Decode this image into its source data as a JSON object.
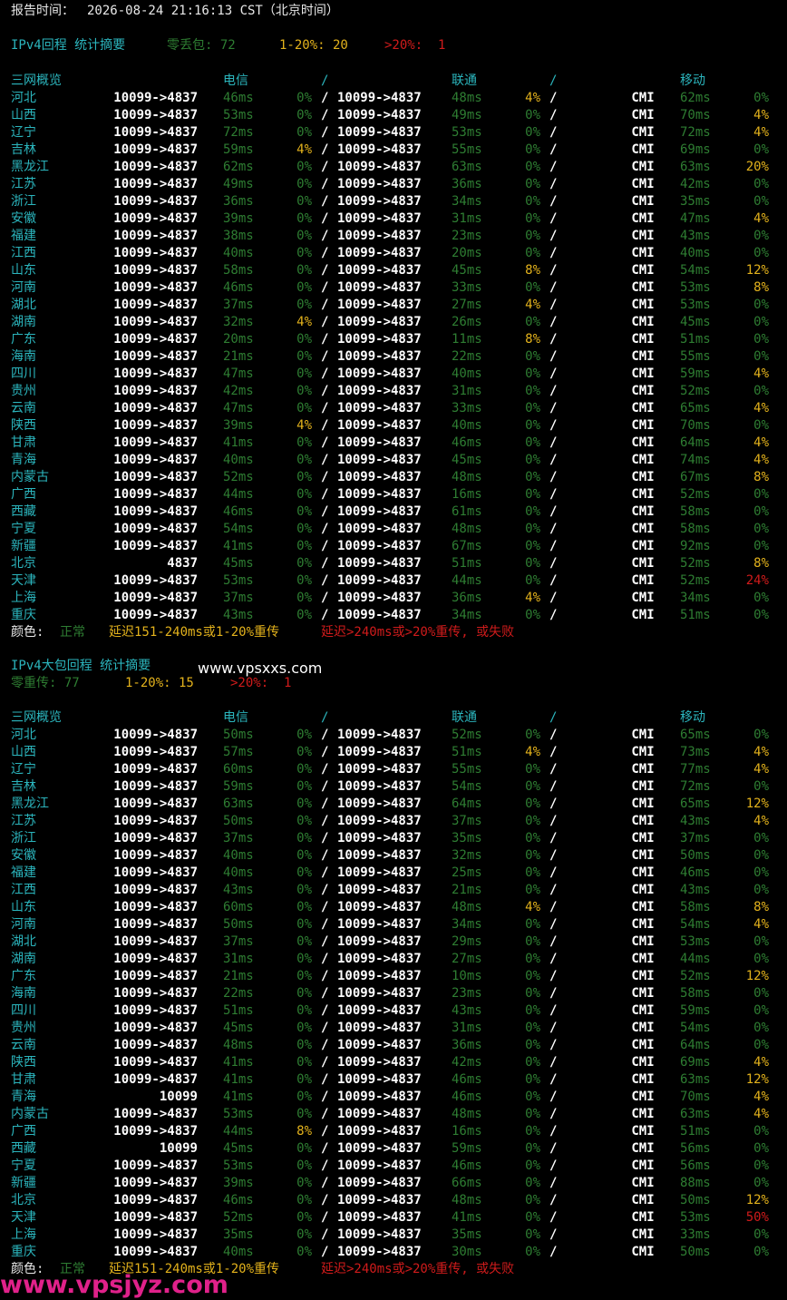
{
  "report": {
    "label": "报告时间：",
    "time": "2026-08-24 21:16:13 CST（北京时间）"
  },
  "colors": {
    "normal": "#2e7d32",
    "warn": "#e3b21c",
    "bad": "#d01b1b",
    "accent": "#2bb5bd"
  },
  "sections": [
    {
      "title": "IPv4回程 统计摘要",
      "summary": {
        "zero_label": "零丢包: 72",
        "mid_label": "1-20%: 20",
        "high_label": ">20%:  1"
      },
      "summary_inline": true,
      "header": {
        "region": "三网概览",
        "ct": "电信",
        "sep": "/",
        "cu": "联通",
        "cm": "移动"
      },
      "rows": [
        [
          "河北",
          "10099->4837",
          "46ms",
          "0%",
          "10099->4837",
          "48ms",
          "4%",
          "CMI",
          "62ms",
          "0%"
        ],
        [
          "山西",
          "10099->4837",
          "53ms",
          "0%",
          "10099->4837",
          "49ms",
          "0%",
          "CMI",
          "70ms",
          "4%"
        ],
        [
          "辽宁",
          "10099->4837",
          "72ms",
          "0%",
          "10099->4837",
          "53ms",
          "0%",
          "CMI",
          "72ms",
          "4%"
        ],
        [
          "吉林",
          "10099->4837",
          "59ms",
          "4%",
          "10099->4837",
          "55ms",
          "0%",
          "CMI",
          "69ms",
          "0%"
        ],
        [
          "黑龙江",
          "10099->4837",
          "62ms",
          "0%",
          "10099->4837",
          "63ms",
          "0%",
          "CMI",
          "63ms",
          "20%"
        ],
        [
          "江苏",
          "10099->4837",
          "49ms",
          "0%",
          "10099->4837",
          "36ms",
          "0%",
          "CMI",
          "42ms",
          "0%"
        ],
        [
          "浙江",
          "10099->4837",
          "36ms",
          "0%",
          "10099->4837",
          "34ms",
          "0%",
          "CMI",
          "35ms",
          "0%"
        ],
        [
          "安徽",
          "10099->4837",
          "39ms",
          "0%",
          "10099->4837",
          "31ms",
          "0%",
          "CMI",
          "47ms",
          "4%"
        ],
        [
          "福建",
          "10099->4837",
          "38ms",
          "0%",
          "10099->4837",
          "23ms",
          "0%",
          "CMI",
          "43ms",
          "0%"
        ],
        [
          "江西",
          "10099->4837",
          "40ms",
          "0%",
          "10099->4837",
          "20ms",
          "0%",
          "CMI",
          "40ms",
          "0%"
        ],
        [
          "山东",
          "10099->4837",
          "58ms",
          "0%",
          "10099->4837",
          "45ms",
          "8%",
          "CMI",
          "54ms",
          "12%"
        ],
        [
          "河南",
          "10099->4837",
          "46ms",
          "0%",
          "10099->4837",
          "33ms",
          "0%",
          "CMI",
          "53ms",
          "8%"
        ],
        [
          "湖北",
          "10099->4837",
          "37ms",
          "0%",
          "10099->4837",
          "27ms",
          "4%",
          "CMI",
          "53ms",
          "0%"
        ],
        [
          "湖南",
          "10099->4837",
          "32ms",
          "4%",
          "10099->4837",
          "26ms",
          "0%",
          "CMI",
          "45ms",
          "0%"
        ],
        [
          "广东",
          "10099->4837",
          "20ms",
          "0%",
          "10099->4837",
          "11ms",
          "8%",
          "CMI",
          "51ms",
          "0%"
        ],
        [
          "海南",
          "10099->4837",
          "21ms",
          "0%",
          "10099->4837",
          "22ms",
          "0%",
          "CMI",
          "55ms",
          "0%"
        ],
        [
          "四川",
          "10099->4837",
          "47ms",
          "0%",
          "10099->4837",
          "40ms",
          "0%",
          "CMI",
          "59ms",
          "4%"
        ],
        [
          "贵州",
          "10099->4837",
          "42ms",
          "0%",
          "10099->4837",
          "31ms",
          "0%",
          "CMI",
          "52ms",
          "0%"
        ],
        [
          "云南",
          "10099->4837",
          "47ms",
          "0%",
          "10099->4837",
          "33ms",
          "0%",
          "CMI",
          "65ms",
          "4%"
        ],
        [
          "陕西",
          "10099->4837",
          "39ms",
          "4%",
          "10099->4837",
          "40ms",
          "0%",
          "CMI",
          "70ms",
          "0%"
        ],
        [
          "甘肃",
          "10099->4837",
          "41ms",
          "0%",
          "10099->4837",
          "46ms",
          "0%",
          "CMI",
          "64ms",
          "4%"
        ],
        [
          "青海",
          "10099->4837",
          "40ms",
          "0%",
          "10099->4837",
          "45ms",
          "0%",
          "CMI",
          "74ms",
          "4%"
        ],
        [
          "内蒙古",
          "10099->4837",
          "52ms",
          "0%",
          "10099->4837",
          "48ms",
          "0%",
          "CMI",
          "67ms",
          "8%"
        ],
        [
          "广西",
          "10099->4837",
          "44ms",
          "0%",
          "10099->4837",
          "16ms",
          "0%",
          "CMI",
          "52ms",
          "0%"
        ],
        [
          "西藏",
          "10099->4837",
          "46ms",
          "0%",
          "10099->4837",
          "61ms",
          "0%",
          "CMI",
          "58ms",
          "0%"
        ],
        [
          "宁夏",
          "10099->4837",
          "54ms",
          "0%",
          "10099->4837",
          "48ms",
          "0%",
          "CMI",
          "58ms",
          "0%"
        ],
        [
          "新疆",
          "10099->4837",
          "41ms",
          "0%",
          "10099->4837",
          "67ms",
          "0%",
          "CMI",
          "92ms",
          "0%"
        ],
        [
          "北京",
          "4837",
          "45ms",
          "0%",
          "10099->4837",
          "51ms",
          "0%",
          "CMI",
          "52ms",
          "8%"
        ],
        [
          "天津",
          "10099->4837",
          "53ms",
          "0%",
          "10099->4837",
          "44ms",
          "0%",
          "CMI",
          "52ms",
          "24%"
        ],
        [
          "上海",
          "10099->4837",
          "37ms",
          "0%",
          "10099->4837",
          "36ms",
          "4%",
          "CMI",
          "34ms",
          "0%"
        ],
        [
          "重庆",
          "10099->4837",
          "43ms",
          "0%",
          "10099->4837",
          "34ms",
          "0%",
          "CMI",
          "51ms",
          "0%"
        ]
      ],
      "legend": {
        "label": "颜色:",
        "normal": "正常",
        "warn": "延迟151-240ms或1-20%重传",
        "bad": "延迟>240ms或>20%重传, 或失败"
      }
    },
    {
      "title": "IPv4大包回程 统计摘要",
      "summary": {
        "zero_label": "零重传: 77",
        "mid_label": "1-20%: 15",
        "high_label": ">20%:  1"
      },
      "summary_inline": false,
      "header": {
        "region": "三网概览",
        "ct": "电信",
        "sep": "/",
        "cu": "联通",
        "cm": "移动"
      },
      "rows": [
        [
          "河北",
          "10099->4837",
          "50ms",
          "0%",
          "10099->4837",
          "52ms",
          "0%",
          "CMI",
          "65ms",
          "0%"
        ],
        [
          "山西",
          "10099->4837",
          "57ms",
          "0%",
          "10099->4837",
          "51ms",
          "4%",
          "CMI",
          "73ms",
          "4%"
        ],
        [
          "辽宁",
          "10099->4837",
          "60ms",
          "0%",
          "10099->4837",
          "55ms",
          "0%",
          "CMI",
          "77ms",
          "4%"
        ],
        [
          "吉林",
          "10099->4837",
          "59ms",
          "0%",
          "10099->4837",
          "54ms",
          "0%",
          "CMI",
          "72ms",
          "0%"
        ],
        [
          "黑龙江",
          "10099->4837",
          "63ms",
          "0%",
          "10099->4837",
          "64ms",
          "0%",
          "CMI",
          "65ms",
          "12%"
        ],
        [
          "江苏",
          "10099->4837",
          "50ms",
          "0%",
          "10099->4837",
          "37ms",
          "0%",
          "CMI",
          "43ms",
          "4%"
        ],
        [
          "浙江",
          "10099->4837",
          "37ms",
          "0%",
          "10099->4837",
          "35ms",
          "0%",
          "CMI",
          "37ms",
          "0%"
        ],
        [
          "安徽",
          "10099->4837",
          "40ms",
          "0%",
          "10099->4837",
          "32ms",
          "0%",
          "CMI",
          "50ms",
          "0%"
        ],
        [
          "福建",
          "10099->4837",
          "40ms",
          "0%",
          "10099->4837",
          "25ms",
          "0%",
          "CMI",
          "46ms",
          "0%"
        ],
        [
          "江西",
          "10099->4837",
          "43ms",
          "0%",
          "10099->4837",
          "21ms",
          "0%",
          "CMI",
          "43ms",
          "0%"
        ],
        [
          "山东",
          "10099->4837",
          "60ms",
          "0%",
          "10099->4837",
          "48ms",
          "4%",
          "CMI",
          "58ms",
          "8%"
        ],
        [
          "河南",
          "10099->4837",
          "50ms",
          "0%",
          "10099->4837",
          "34ms",
          "0%",
          "CMI",
          "54ms",
          "4%"
        ],
        [
          "湖北",
          "10099->4837",
          "37ms",
          "0%",
          "10099->4837",
          "29ms",
          "0%",
          "CMI",
          "53ms",
          "0%"
        ],
        [
          "湖南",
          "10099->4837",
          "31ms",
          "0%",
          "10099->4837",
          "27ms",
          "0%",
          "CMI",
          "44ms",
          "0%"
        ],
        [
          "广东",
          "10099->4837",
          "21ms",
          "0%",
          "10099->4837",
          "10ms",
          "0%",
          "CMI",
          "52ms",
          "12%"
        ],
        [
          "海南",
          "10099->4837",
          "22ms",
          "0%",
          "10099->4837",
          "23ms",
          "0%",
          "CMI",
          "58ms",
          "0%"
        ],
        [
          "四川",
          "10099->4837",
          "51ms",
          "0%",
          "10099->4837",
          "43ms",
          "0%",
          "CMI",
          "59ms",
          "0%"
        ],
        [
          "贵州",
          "10099->4837",
          "45ms",
          "0%",
          "10099->4837",
          "31ms",
          "0%",
          "CMI",
          "54ms",
          "0%"
        ],
        [
          "云南",
          "10099->4837",
          "48ms",
          "0%",
          "10099->4837",
          "36ms",
          "0%",
          "CMI",
          "64ms",
          "0%"
        ],
        [
          "陕西",
          "10099->4837",
          "41ms",
          "0%",
          "10099->4837",
          "42ms",
          "0%",
          "CMI",
          "69ms",
          "4%"
        ],
        [
          "甘肃",
          "10099->4837",
          "41ms",
          "0%",
          "10099->4837",
          "46ms",
          "0%",
          "CMI",
          "63ms",
          "12%"
        ],
        [
          "青海",
          "10099",
          "41ms",
          "0%",
          "10099->4837",
          "46ms",
          "0%",
          "CMI",
          "70ms",
          "4%"
        ],
        [
          "内蒙古",
          "10099->4837",
          "53ms",
          "0%",
          "10099->4837",
          "48ms",
          "0%",
          "CMI",
          "63ms",
          "4%"
        ],
        [
          "广西",
          "10099->4837",
          "44ms",
          "8%",
          "10099->4837",
          "16ms",
          "0%",
          "CMI",
          "51ms",
          "0%"
        ],
        [
          "西藏",
          "10099",
          "45ms",
          "0%",
          "10099->4837",
          "59ms",
          "0%",
          "CMI",
          "56ms",
          "0%"
        ],
        [
          "宁夏",
          "10099->4837",
          "53ms",
          "0%",
          "10099->4837",
          "46ms",
          "0%",
          "CMI",
          "56ms",
          "0%"
        ],
        [
          "新疆",
          "10099->4837",
          "39ms",
          "0%",
          "10099->4837",
          "66ms",
          "0%",
          "CMI",
          "88ms",
          "0%"
        ],
        [
          "北京",
          "10099->4837",
          "46ms",
          "0%",
          "10099->4837",
          "48ms",
          "0%",
          "CMI",
          "50ms",
          "12%"
        ],
        [
          "天津",
          "10099->4837",
          "52ms",
          "0%",
          "10099->4837",
          "41ms",
          "0%",
          "CMI",
          "53ms",
          "50%"
        ],
        [
          "上海",
          "10099->4837",
          "35ms",
          "0%",
          "10099->4837",
          "35ms",
          "0%",
          "CMI",
          "33ms",
          "0%"
        ],
        [
          "重庆",
          "10099->4837",
          "40ms",
          "0%",
          "10099->4837",
          "30ms",
          "0%",
          "CMI",
          "50ms",
          "0%"
        ]
      ],
      "legend": {
        "label": "颜色:",
        "normal": "正常",
        "warn": "延迟151-240ms或1-20%重传",
        "bad": "延迟>240ms或>20%重传, 或失败"
      }
    }
  ],
  "watermarks": {
    "inline": "www.vpsxxs.com",
    "footer": "www.vpsjyz.com"
  }
}
